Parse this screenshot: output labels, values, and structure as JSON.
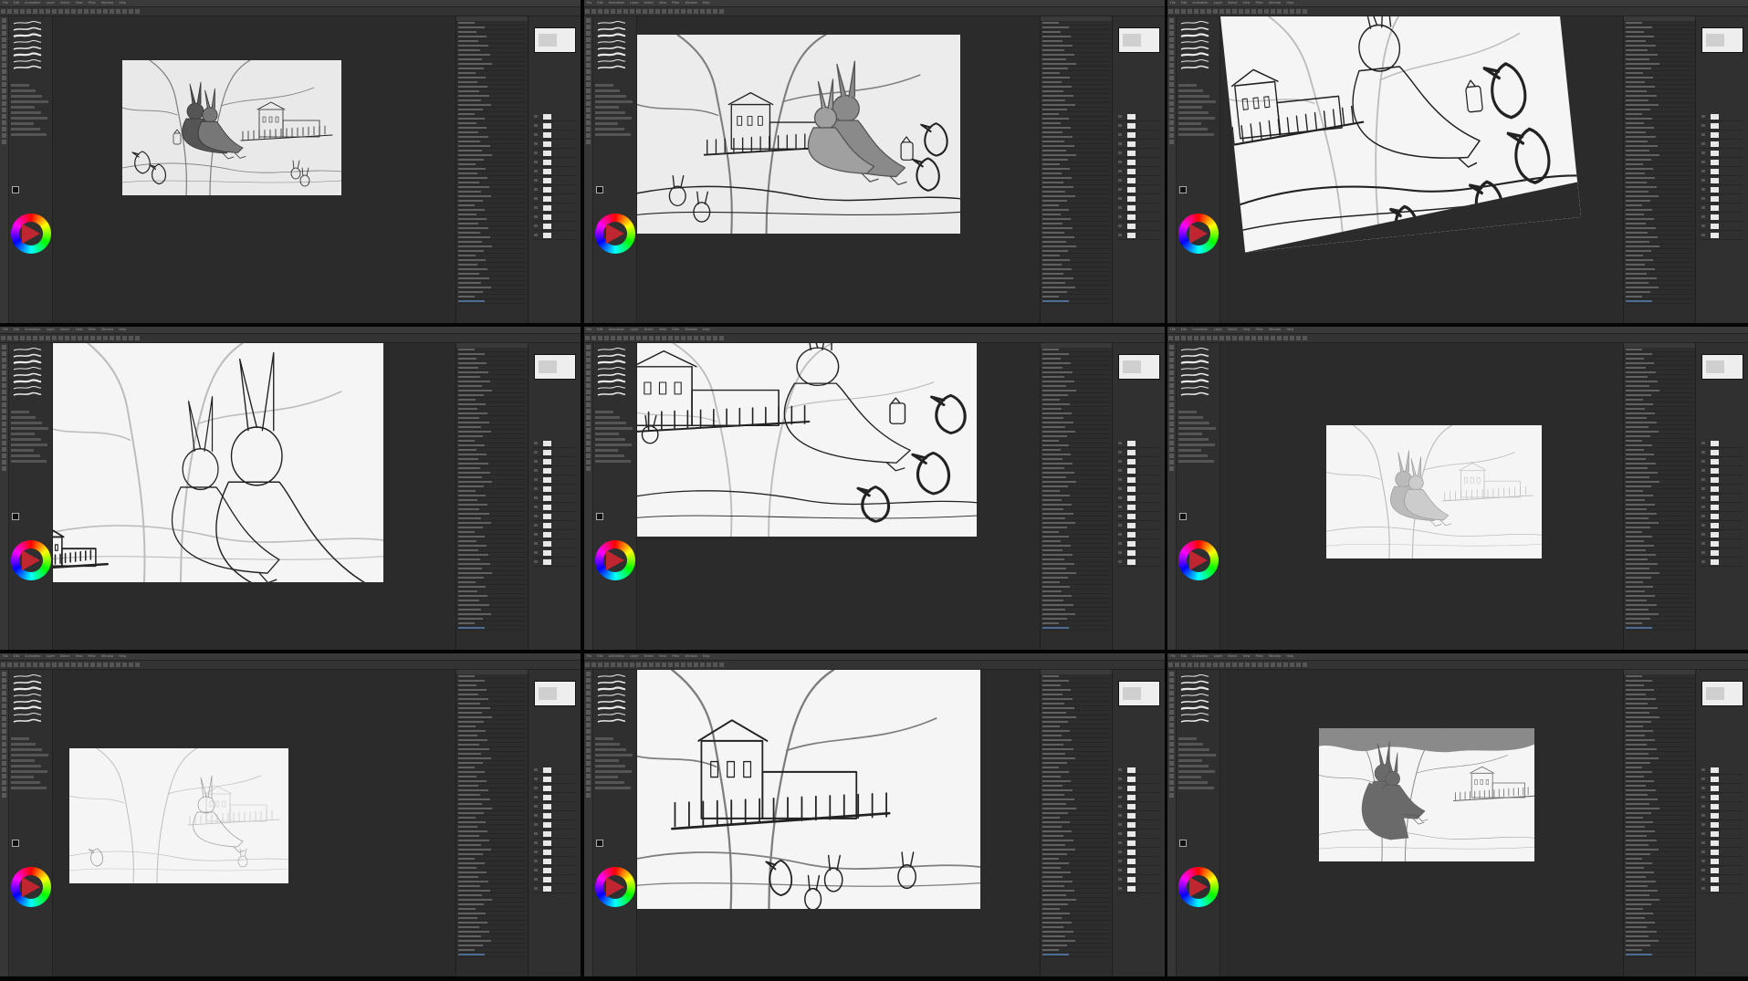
{
  "app": {
    "menu": [
      "File",
      "Edit",
      "Animation",
      "Layer",
      "Select",
      "View",
      "Filter",
      "Window",
      "Help"
    ]
  },
  "panels": [
    {
      "id": "p1",
      "sheet_style": "small-mid",
      "scene": "shaded-overview"
    },
    {
      "id": "p2",
      "sheet_style": "large",
      "scene": "grey-zoom"
    },
    {
      "id": "p3",
      "sheet_style": "rotated",
      "scene": "girl-birds-rotated"
    },
    {
      "id": "p4",
      "sheet_style": "full",
      "scene": "bunny-closeup"
    },
    {
      "id": "p5",
      "sheet_style": "wide",
      "scene": "building-girl-birds"
    },
    {
      "id": "p6",
      "sheet_style": "small-center",
      "scene": "faint-overview"
    },
    {
      "id": "p7",
      "sheet_style": "small-left",
      "scene": "lineart-overview"
    },
    {
      "id": "p8",
      "sheet_style": "tall",
      "scene": "building-fence"
    },
    {
      "id": "p9",
      "sheet_style": "small-center-dark",
      "scene": "flat-silhouette"
    }
  ],
  "colors": {
    "ui_dark": "#2b2b2b",
    "panel_bg": "#303030",
    "selection_blue": "#3d5f8a",
    "paper": "#f5f5f5"
  }
}
